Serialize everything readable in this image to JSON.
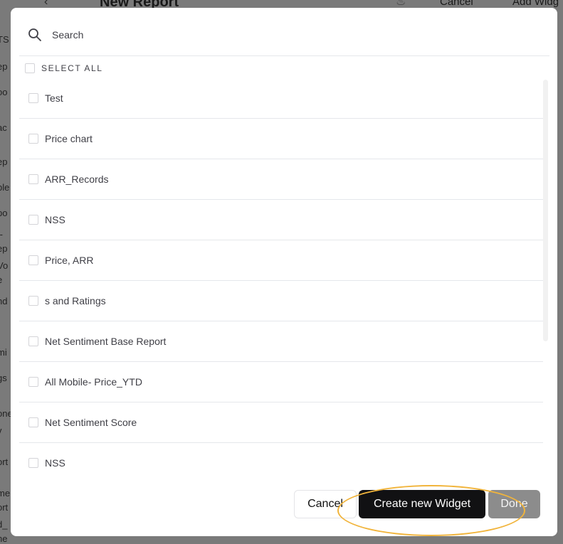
{
  "background": {
    "title": "New Report",
    "cancel_label": "Cancel",
    "add_widget_label": "Add Widg",
    "sidebar_fragments": [
      "TS",
      "ep",
      "oo",
      "ac",
      "ep",
      "ble",
      "po",
      "t-",
      "ep",
      "Vo",
      "e",
      "nd",
      "mi",
      "gs",
      "one",
      "v",
      "ort",
      "t",
      "me",
      "ort",
      "d_",
      "ne"
    ]
  },
  "modal": {
    "search": {
      "placeholder": "Search",
      "value": ""
    },
    "select_all_label": "SELECT ALL",
    "items": [
      {
        "label": "Test",
        "checked": false
      },
      {
        "label": "Price chart",
        "checked": false
      },
      {
        "label": "ARR_Records",
        "checked": false
      },
      {
        "label": "NSS",
        "checked": false
      },
      {
        "label": "Price, ARR",
        "checked": false
      },
      {
        "label": "s and Ratings",
        "checked": false
      },
      {
        "label": "Net Sentiment Base Report",
        "checked": false
      },
      {
        "label": "All Mobile- Price_YTD",
        "checked": false
      },
      {
        "label": "Net Sentiment Score",
        "checked": false
      },
      {
        "label": "NSS",
        "checked": false
      }
    ],
    "footer": {
      "cancel_label": "Cancel",
      "create_label": "Create new Widget",
      "done_label": "Done"
    }
  },
  "colors": {
    "highlight": "#f1b43b",
    "primary_button": "#111113",
    "disabled_button": "#8c8c8c"
  },
  "icons": {
    "search": "search-icon",
    "back": "chevron-left-icon",
    "flame": "flame-icon"
  }
}
